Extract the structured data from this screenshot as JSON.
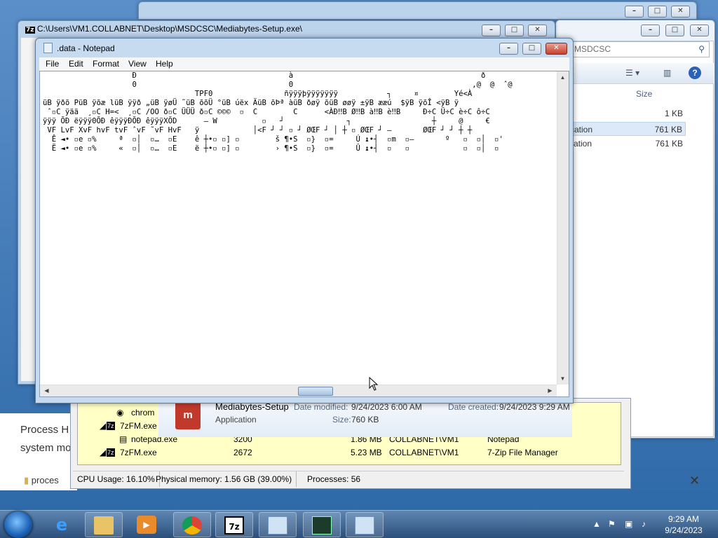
{
  "zfm_window": {
    "title": "C:\\Users\\VM1.COLLABNET\\Desktop\\MSDCSC\\Mediabytes-Setup.exe\\"
  },
  "explorer": {
    "search_placeholder": "MSDCSC",
    "size_header": "Size",
    "rows": [
      {
        "name": "",
        "size": "1 KB"
      },
      {
        "name": "cation",
        "size": "761 KB"
      },
      {
        "name": "cation",
        "size": "761 KB"
      }
    ],
    "details": {
      "name": "Mediabytes-Setup",
      "type": "Application",
      "modified_label": "Date modified:",
      "modified_value": "9/24/2023 6:00 AM",
      "created_label": "Date created:",
      "created_value": "9/24/2023 9:29 AM",
      "size_label": "Size:",
      "size_value": "760 KB"
    }
  },
  "notepad": {
    "title": ".data - Notepad",
    "menu": [
      "File",
      "Edit",
      "Format",
      "View",
      "Help"
    ],
    "content": "                    Ð                                  à                                          ð\n                    0                                  0                                        ‚@  @  ˆ@\n                                  TPF0                ñÿÿÿþÿÿÿÿÿÿÿ           ┐     ¤        Yé<À\nüB ÿðõ PüB ÿõæ lüB ÿÿð „üB ÿøÜ ˜üB õõÜ °üB úëx ÄüB õÞª àüB ðøÿ õüB øøÿ ±ÿB ææú  $ÿB ÿõÎ <ÿB ÿ\n ˆ▫C ÿää  ¸▫C H=<  ¸▫C /OO ð▫C ÜÜÜ ð▫C ©©©  ▫  C        C      <ÀÐ‼B Ø‼B à‼B è‼B     Ð÷C Ü÷C è÷C ô÷C\nÿÿÿ ÕÐ ëÿÿÿ0ÕÐ êÿÿÿÐÕÐ êÿÿÿXÕD      — W          ▫   ┘              ┐                  ┼     @     €\n VF LvF XvF hvF tvF ˆvF ˜vF HvF   ÿ            │<F ┘ ┘ ▫ ┘ ØŒF ┘ │ ┼ ▫ ØŒF ┘ –       ØŒF ┘ ┘ ┼ ┼\n  Ê ◄• ▫e ▫%     ª  ▫│  ▫…  ▫E    ê ┼•▫ ▫] ▫        š ¶•S  ▫}  ▫=     Ú ↨•┤  ▫m  ▫–       º   ▫  ▫│  ▫'\n  Ë ◄• ▫e ▫%     «  ▫│  ▫…  ▫E    ë ┼•▫ ▫] ▫        › ¶•S  ▫}  ▫=     Û ↨•┤  ▫   ▫            ▫  ▫│  ▫"
  },
  "process_explorer": {
    "rows": [
      {
        "name": "chrom",
        "pid": "",
        "cpu": "",
        "mem": "",
        "user": "",
        "desc": ""
      },
      {
        "name": "7zFM.exe",
        "pid": "",
        "cpu": "",
        "mem": "",
        "user": "",
        "desc": ""
      },
      {
        "name": "notepad.exe",
        "pid": "3200",
        "cpu": "",
        "mem": "1.86 MB",
        "user": "COLLABNET\\VM1",
        "desc": "Notepad"
      },
      {
        "name": "7zFM.exe",
        "pid": "2672",
        "cpu": "",
        "mem": "5.23 MB",
        "user": "COLLABNET\\VM1",
        "desc": "7-Zip File Manager"
      }
    ],
    "status": {
      "cpu": "CPU Usage: 16.10%",
      "mem": "Physical memory: 1.56 GB (39.00%)",
      "procs": "Processes: 56"
    }
  },
  "left_window": {
    "line1": "Process H",
    "line2": "system mo",
    "item": "proces"
  },
  "taskbar": {
    "items": [
      "internet-explorer",
      "file-explorer",
      "media-player",
      "chrome",
      "7zip",
      "notepad",
      "task-manager",
      "notepad"
    ],
    "clock_time": "9:29 AM",
    "clock_date": "9/24/2023"
  }
}
